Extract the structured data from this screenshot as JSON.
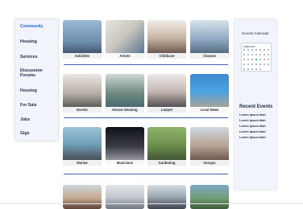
{
  "sidebar": {
    "items": [
      {
        "label": "Community",
        "active": true
      },
      {
        "label": "Housing"
      },
      {
        "label": "Services"
      },
      {
        "label": "Discussion\nForums"
      },
      {
        "label": "Housing"
      },
      {
        "label": "For Sale"
      },
      {
        "label": "Jobs"
      },
      {
        "label": "Gigs"
      }
    ]
  },
  "categories": {
    "row1": [
      "Activities",
      "Artists",
      "Childcare",
      "Classes"
    ],
    "row2": [
      "Events",
      "House-cleaning",
      "Lawyer",
      "Local News"
    ],
    "row3": [
      "Marine",
      "Musicians",
      "Gardening",
      "Groups"
    ],
    "row4": [
      "",
      "",
      "",
      ""
    ]
  },
  "right_panel": {
    "calendar_title": "Events Calendar",
    "calendar_month": "FEBRUARY",
    "recent_title": "Recent Events",
    "recent_items": [
      "Lorem Ipsum blah",
      "Lorem Ipsum blah",
      "Lorem Ipsum blah",
      "Lorem Ipsum blah",
      "Lorem Ipsum blah"
    ]
  },
  "colors": {
    "accent": "#2563eb",
    "divider": "#3b63a8",
    "panel_bg": "#f1f5fb"
  }
}
